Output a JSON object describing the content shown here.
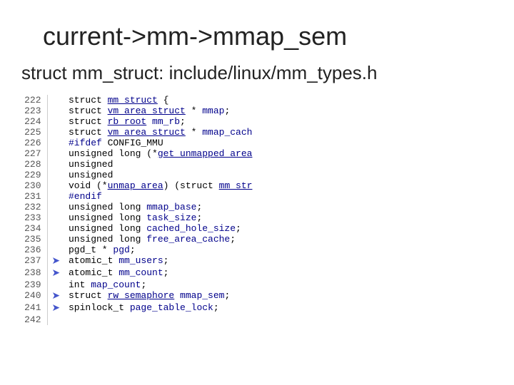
{
  "title": "current->mm->mmap_sem",
  "subtitle": "struct mm_struct: include/linux/mm_types.h",
  "lines": [
    {
      "num": "222",
      "code": "struct <span class='type'>mm_struct</span> {",
      "arrow": false
    },
    {
      "num": "223",
      "code": "        struct <span class='type'>vm_area_struct</span> * <span class='field'>mmap</span>;",
      "arrow": false
    },
    {
      "num": "224",
      "code": "        struct <span class='type'>rb_root</span> <span class='field'>mm_rb</span>;",
      "arrow": false
    },
    {
      "num": "225",
      "code": "        struct <span class='type'>vm_area_struct</span> * <span class='field'>mmap_cach</span>",
      "arrow": false
    },
    {
      "num": "226",
      "code": "<span class='kw'>#ifdef</span> CONFIG_MMU",
      "arrow": false
    },
    {
      "num": "227",
      "code": "        unsigned long (*<span class='type'>get_unmapped_area</span>",
      "arrow": false
    },
    {
      "num": "228",
      "code": "                                        unsigned",
      "arrow": false
    },
    {
      "num": "229",
      "code": "                                        unsigned",
      "arrow": false
    },
    {
      "num": "230",
      "code": "        void (*<span class='type'>unmap_area</span>) (struct <span class='type'>mm_str</span>",
      "arrow": false
    },
    {
      "num": "231",
      "code": "<span class='kw'>#endif</span>",
      "arrow": false
    },
    {
      "num": "232",
      "code": "        unsigned long <span class='field'>mmap_base</span>;",
      "arrow": false
    },
    {
      "num": "233",
      "code": "        unsigned long <span class='field'>task_size</span>;",
      "arrow": false
    },
    {
      "num": "234",
      "code": "        unsigned long <span class='field'>cached_hole_size</span>;",
      "arrow": false
    },
    {
      "num": "235",
      "code": "        unsigned long <span class='field'>free_area_cache</span>;",
      "arrow": false
    },
    {
      "num": "236",
      "code": "        pgd_t * <span class='field'>pgd</span>;",
      "arrow": false
    },
    {
      "num": "237",
      "code": "        atomic_t <span class='field'>mm_users</span>;",
      "arrow": true
    },
    {
      "num": "238",
      "code": "        atomic_t <span class='field'>mm_count</span>;",
      "arrow": true
    },
    {
      "num": "239",
      "code": "        int <span class='field'>map_count</span>;",
      "arrow": false
    },
    {
      "num": "240",
      "code": "        struct <span class='type'>rw_semaphore</span> <span class='field'>mmap_sem</span>;",
      "arrow": true
    },
    {
      "num": "241",
      "code": "        spinlock_t <span class='field'>page_table_lock</span>;",
      "arrow": true
    },
    {
      "num": "242",
      "code": "",
      "arrow": false
    }
  ],
  "map_count_label": "map count"
}
